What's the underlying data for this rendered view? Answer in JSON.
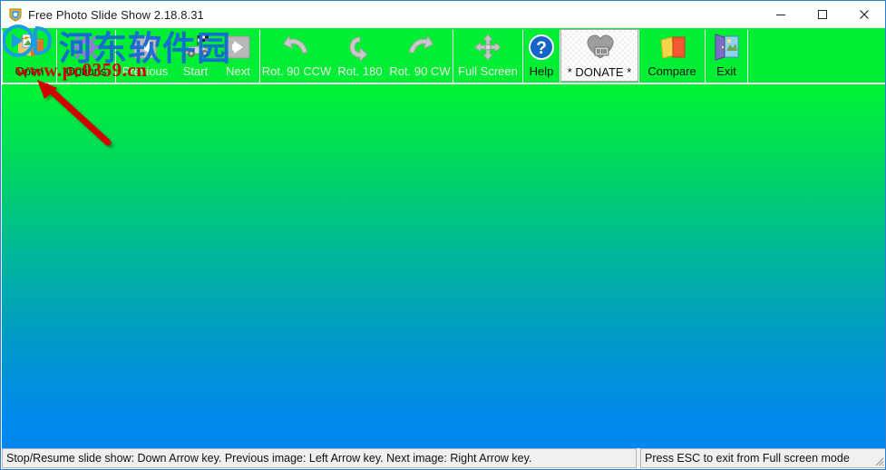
{
  "window": {
    "title": "Free Photo Slide Show 2.18.8.31",
    "app_icon": "app-shield-icon",
    "controls": {
      "minimize": "minimize-icon",
      "maximize": "maximize-icon",
      "close": "close-icon"
    }
  },
  "toolbar": {
    "buttons": [
      {
        "label": "Open",
        "icon": "open-folder-icon",
        "state": "enabled"
      },
      {
        "label": "Options",
        "icon": "gear-icon",
        "state": "enabled"
      },
      {
        "label": "Previous",
        "icon": "left-arrow-icon",
        "state": "disabled"
      },
      {
        "label": "Start",
        "icon": "race-car-flag-icon",
        "state": "disabled"
      },
      {
        "label": "Next",
        "icon": "right-arrow-icon",
        "state": "disabled"
      },
      {
        "label": "Rot. 90 CCW",
        "icon": "rotate-ccw-icon",
        "state": "disabled"
      },
      {
        "label": "Rot. 180",
        "icon": "rotate-180-icon",
        "state": "disabled"
      },
      {
        "label": "Rot. 90 CW",
        "icon": "rotate-cw-icon",
        "state": "disabled"
      },
      {
        "label": "Full Screen",
        "icon": "fullscreen-arrows-icon",
        "state": "disabled"
      },
      {
        "label": "Help",
        "icon": "question-mark-icon",
        "state": "enabled"
      },
      {
        "label": "* DONATE *",
        "icon": "heart-money-icon",
        "state": "hot"
      },
      {
        "label": "Compare",
        "icon": "compare-cards-icon",
        "state": "enabled"
      },
      {
        "label": "Exit",
        "icon": "exit-door-icon",
        "state": "enabled"
      }
    ]
  },
  "statusbar": {
    "left": "Stop/Resume slide show: Down Arrow key. Previous image: Left Arrow key. Next image: Right Arrow key.",
    "right": "Press ESC to exit from Full screen mode",
    "grip": "resize-grip-icon"
  },
  "watermark": {
    "chinese": "河东软件园",
    "url": "www.pc0359.cn",
    "logo": "watermark-logo-icon"
  },
  "annotation": {
    "arrow": "red-pointer-arrow"
  },
  "colors": {
    "toolbar_green": "#00ee33",
    "image_gradient_top": "#00f533",
    "image_gradient_bottom": "#0088f2",
    "titlebar_border": "#2a7fd4",
    "annotation_red": "#d20000",
    "watermark_blue": "#1565d8",
    "watermark_red": "#d40000"
  }
}
